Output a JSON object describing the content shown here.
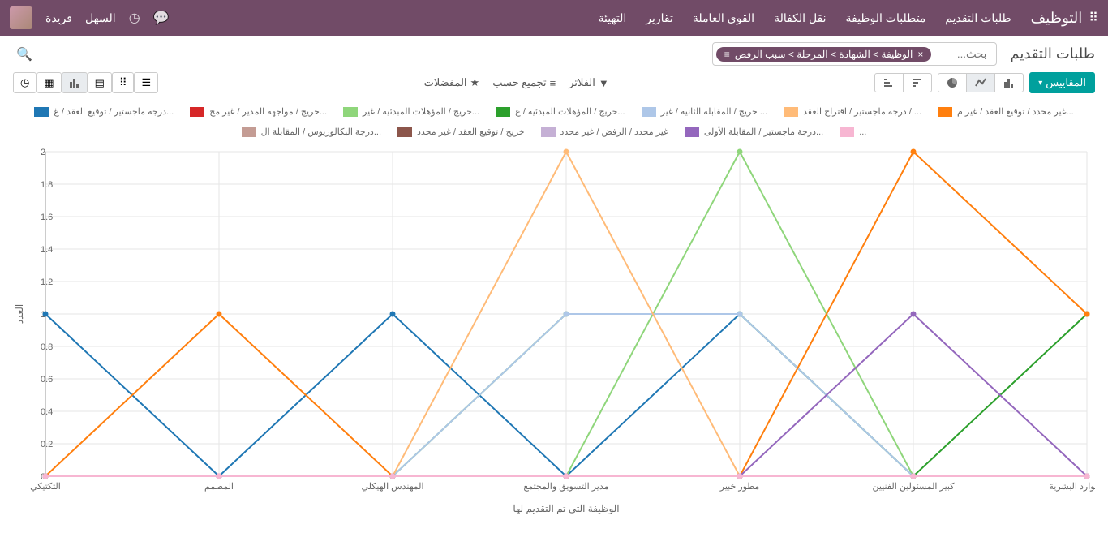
{
  "topbar": {
    "brand": "التوظيف",
    "menu": [
      "طلبات التقديم",
      "متطلبات الوظيفة",
      "نقل الكفالة",
      "القوى العاملة",
      "تقارير",
      "التهيئة"
    ],
    "user": "فريدة",
    "easy": "السهل"
  },
  "breadcrumb": "طلبات التقديم",
  "search": {
    "facet_icon": "≡",
    "facet_text": "الوظيفة > الشهادة  > المرحلة > سبب الرفض",
    "placeholder": "بحث..."
  },
  "buttons": {
    "measures": "المقاييس",
    "filters": "الفلاتر",
    "groupby": "تجميع حسب",
    "favorites": "المفضلات"
  },
  "chart_data": {
    "type": "line",
    "xlabel": "الوظيفة التي تم التقديم لها",
    "ylabel": "العدد",
    "ylim": [
      0,
      2
    ],
    "yticks": [
      0,
      0.2,
      0.4,
      0.6,
      0.8,
      1,
      1.2,
      1.4,
      1.6,
      1.8,
      2
    ],
    "categories": [
      "التكتيكي",
      "المصمم",
      "المهندس الهيكلي",
      "مدير التسويق والمجتمع",
      "مطور خبير",
      "كبير المسئولين الفنيين",
      "مدير الموارد البشرية"
    ],
    "series": [
      {
        "name": "درجة ماجستير / توقيع العقد / غ...",
        "color": "#1f77b4",
        "values": [
          1,
          0,
          1,
          0,
          1,
          0,
          0
        ]
      },
      {
        "name": "خريج / مواجهة المدير / غير مح...",
        "color": "#d62728",
        "values": [
          0,
          0,
          0,
          0,
          0,
          0,
          0
        ]
      },
      {
        "name": "خريج / المؤهلات المبدئية / غير...",
        "color": "#8fd67b",
        "values": [
          0,
          0,
          0,
          0,
          2,
          0,
          0
        ]
      },
      {
        "name": "خريج / المؤهلات المبدئية / غ...",
        "color": "#2ca02c",
        "values": [
          0,
          0,
          0,
          1,
          1,
          0,
          1
        ]
      },
      {
        "name": "خريج / المقابلة الثانية / غير ...",
        "color": "#aec7e8",
        "values": [
          0,
          0,
          0,
          1,
          1,
          0,
          0
        ]
      },
      {
        "name": "درجة ماجستير / اقتراح العقد / ...",
        "color": "#ffbb78",
        "values": [
          0,
          0,
          0,
          2,
          0,
          0,
          0
        ]
      },
      {
        "name": "غير محدد / توقيع العقد / غير م...",
        "color": "#ff7f0e",
        "values": [
          0,
          1,
          0,
          0,
          0,
          2,
          1
        ]
      },
      {
        "name": "درجة البكالوريوس / المقابلة ال...",
        "color": "#c49c94",
        "values": [
          0,
          0,
          0,
          0,
          0,
          0,
          0
        ]
      },
      {
        "name": "خريج / توقيع العقد / غير محدد",
        "color": "#8c564b",
        "values": [
          0,
          0,
          0,
          0,
          0,
          0,
          0
        ]
      },
      {
        "name": "غير محدد / الرفض / غير محدد",
        "color": "#c5b0d5",
        "values": [
          0,
          0,
          0,
          0,
          0,
          0,
          0
        ]
      },
      {
        "name": "درجة ماجستير / المقابلة الأولى...",
        "color": "#9467bd",
        "values": [
          0,
          0,
          0,
          0,
          0,
          1,
          0
        ]
      },
      {
        "name": "...",
        "color": "#f7b6d2",
        "values": [
          0,
          0,
          0,
          0,
          0,
          0,
          0
        ]
      }
    ]
  }
}
